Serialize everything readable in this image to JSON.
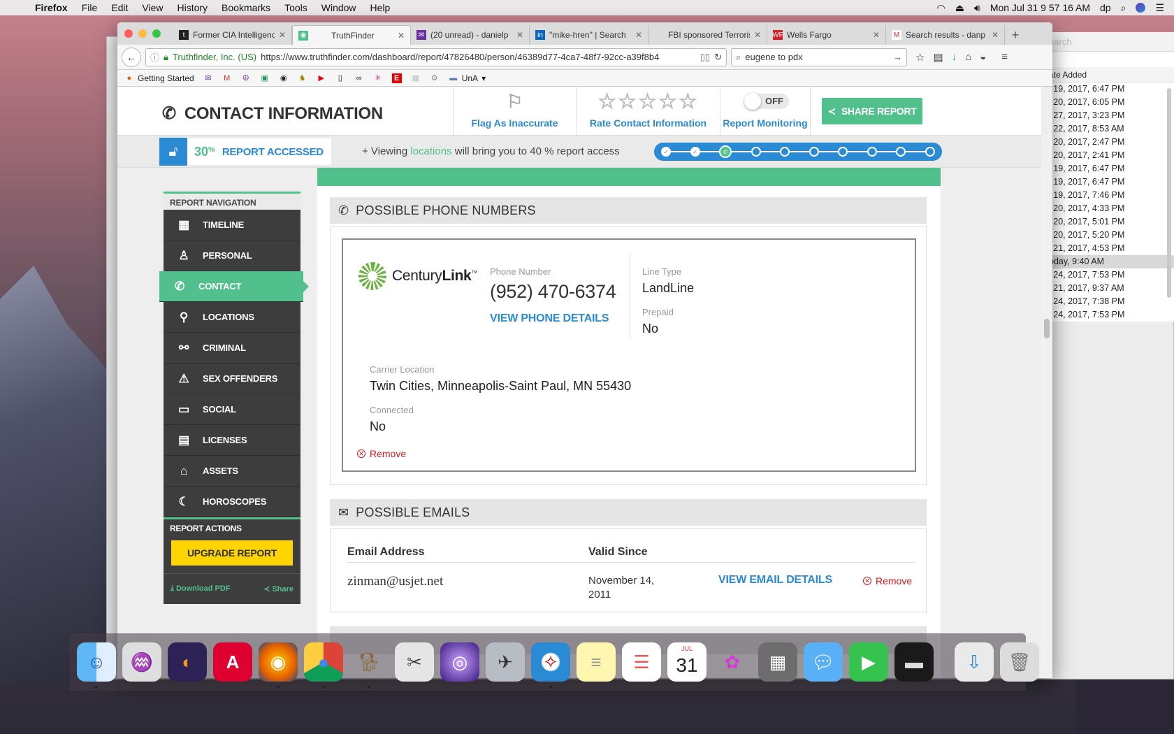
{
  "menubar": {
    "app": "Firefox",
    "items": [
      "File",
      "Edit",
      "View",
      "History",
      "Bookmarks",
      "Tools",
      "Window",
      "Help"
    ],
    "clock": "Mon Jul 31  9 57 16 AM",
    "user": "dp"
  },
  "library": {
    "search_placeholder": "earch",
    "column": "ate Added",
    "rows": [
      "l 19, 2017, 6:47 PM",
      "l 20, 2017, 6:05 PM",
      "l 27, 2017, 3:23 PM",
      "l 22, 2017, 8:53 AM",
      "l 20, 2017, 2:47 PM",
      "l 20, 2017, 2:41 PM",
      "l 19, 2017, 6:47 PM",
      "l 19, 2017, 6:47 PM",
      "l 19, 2017, 7:46 PM",
      "l 20, 2017, 4:33 PM",
      "l 20, 2017, 5:01 PM",
      "l 20, 2017, 5:20 PM",
      "l 21, 2017, 4:53 PM",
      "oday, 9:40 AM",
      "l 24, 2017, 7:53 PM",
      "l 21, 2017, 9:37 AM",
      "l 24, 2017, 7:38 PM",
      "l 24, 2017, 7:53 PM"
    ]
  },
  "tabs": [
    {
      "title": "Former CIA Intelligenc",
      "fav": "t",
      "favcolor": "#222"
    },
    {
      "title": "TruthFinder",
      "fav": "◉",
      "favcolor": "#52c08d"
    },
    {
      "title": "(20 unread) - danielp",
      "fav": "✉",
      "favcolor": "#6a2fa0"
    },
    {
      "title": "\"mike-hren\" | Search",
      "fav": "in",
      "favcolor": "#0a66c2"
    },
    {
      "title": "FBI sponsored Terrorism",
      "fav": "",
      "favcolor": "transparent"
    },
    {
      "title": "Wells Fargo",
      "fav": "WF",
      "favcolor": "#d71e28"
    },
    {
      "title": "Search results - danp",
      "fav": "M",
      "favcolor": "#fff"
    }
  ],
  "nav": {
    "identity": "Truthfinder, Inc. (US)",
    "url": "https://www.truthfinder.com/dashboard/report/47826480/person/46389d77-4ca7-48f7-92cc-a39f8b4",
    "search": "eugene to pdx"
  },
  "bookmarks": {
    "getting_started": "Getting Started",
    "folder": "UnA"
  },
  "header": {
    "title": "CONTACT INFORMATION",
    "flag": "Flag As Inaccurate",
    "rate": "Rate Contact Information",
    "monitoring": "Report Monitoring",
    "toggle": "OFF",
    "share": "SHARE REPORT"
  },
  "access": {
    "percent": "30",
    "percent_sign": "%",
    "label": "REPORT ACCESSED",
    "viewing_prefix": "+ Viewing ",
    "viewing_link": "locations",
    "viewing_suffix": " will bring you to 40 % report access",
    "progress_total": 10,
    "progress_done": 2,
    "progress_current": 3
  },
  "sidebar": {
    "heading": "REPORT NAVIGATION",
    "items": [
      {
        "label": "TIMELINE",
        "icon": "calendar-icon",
        "glyph": "▦"
      },
      {
        "label": "PERSONAL",
        "icon": "person-icon",
        "glyph": "♙"
      },
      {
        "label": "CONTACT",
        "icon": "phone-icon",
        "glyph": "✆"
      },
      {
        "label": "LOCATIONS",
        "icon": "map-pin-icon",
        "glyph": "⚲"
      },
      {
        "label": "CRIMINAL",
        "icon": "handcuffs-icon",
        "glyph": "⚯"
      },
      {
        "label": "SEX OFFENDERS",
        "icon": "warning-icon",
        "glyph": "⚠"
      },
      {
        "label": "SOCIAL",
        "icon": "chat-icon",
        "glyph": "▭"
      },
      {
        "label": "LICENSES",
        "icon": "id-card-icon",
        "glyph": "▤"
      },
      {
        "label": "ASSETS",
        "icon": "home-icon",
        "glyph": "⌂"
      },
      {
        "label": "HOROSCOPES",
        "icon": "moon-icon",
        "glyph": "☾"
      }
    ],
    "actions_heading": "REPORT ACTIONS",
    "upgrade": "UPGRADE REPORT",
    "download": "Download PDF",
    "share": "Share"
  },
  "phones": {
    "heading": "POSSIBLE PHONE NUMBERS",
    "carrier_pre": "Century",
    "carrier_bold": "Link",
    "carrier_tm": "™",
    "phone_label": "Phone Number",
    "phone": "(952) 470-6374",
    "view_details": "VIEW PHONE DETAILS",
    "line_type_label": "Line Type",
    "line_type": "LandLine",
    "prepaid_label": "Prepaid",
    "prepaid": "No",
    "carrier_location_label": "Carrier Location",
    "carrier_location": "Twin Cities, Minneapolis-Saint Paul, MN 55430",
    "connected_label": "Connected",
    "connected": "No",
    "remove": "Remove"
  },
  "emails": {
    "heading": "POSSIBLE EMAILS",
    "col_email": "Email Address",
    "col_valid": "Valid Since",
    "email": "zinman@usjet.net",
    "valid_since": "November 14, 2011",
    "view_details": "VIEW EMAIL DETAILS",
    "remove": "Remove"
  },
  "dock": [
    "finder",
    "sequel-pro",
    "eclipse",
    "angular",
    "firefox",
    "chrome",
    "gimp",
    "screenshot",
    "siri",
    "launchpad",
    "safari",
    "notes",
    "reminders",
    "calendar",
    "photos-flower",
    "calculator",
    "messages",
    "facetime",
    "terminal",
    "downloads",
    "trash"
  ],
  "calendar_day": "31",
  "calendar_month": "JUL"
}
